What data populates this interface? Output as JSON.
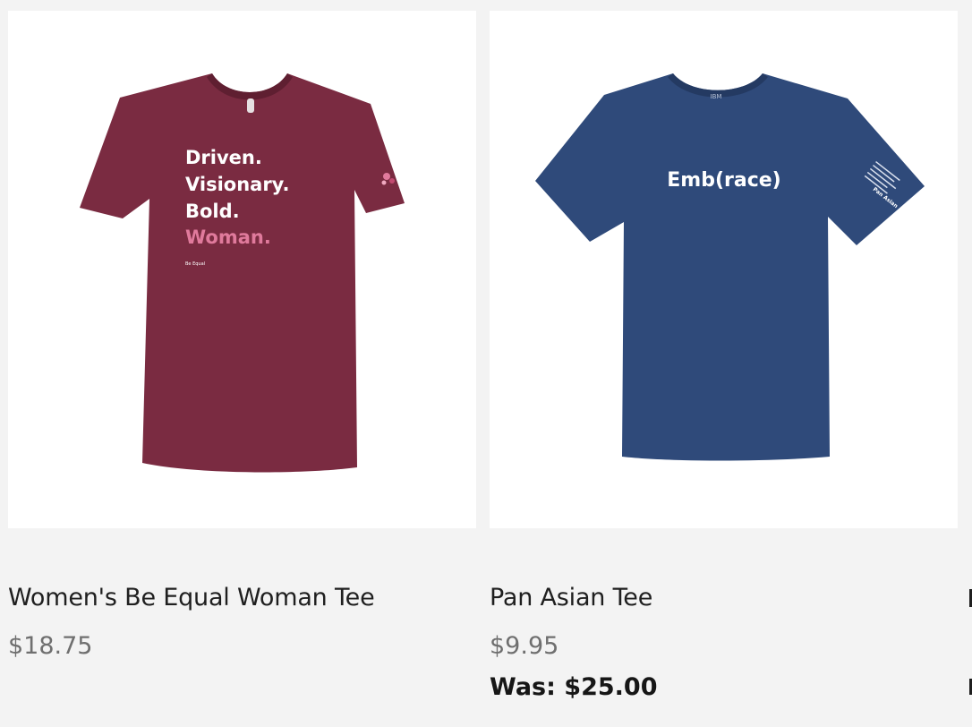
{
  "products": [
    {
      "title": "Women's Be Equal Woman Tee",
      "price": "$18.75",
      "shirt_color": "#7a2b41",
      "shirt_print": [
        "Driven.",
        "Visionary.",
        "Bold.",
        "Woman."
      ],
      "shirt_print_accent": "#e07a9c",
      "shirt_small_print": "Be Equal"
    },
    {
      "title": "Pan Asian Tee",
      "price": "$9.95",
      "was_price": "Was: $25.00",
      "shirt_color": "#2f4a7a",
      "shirt_print": "Emb(race)",
      "sleeve_print": "Pan Asian",
      "collar_logo": "IBM"
    }
  ],
  "colors": {
    "page_background": "#f3f3f3",
    "card_background": "#ffffff",
    "title_text": "#1f1f1f",
    "price_text": "#6f6f6f",
    "was_price_text": "#161616"
  }
}
